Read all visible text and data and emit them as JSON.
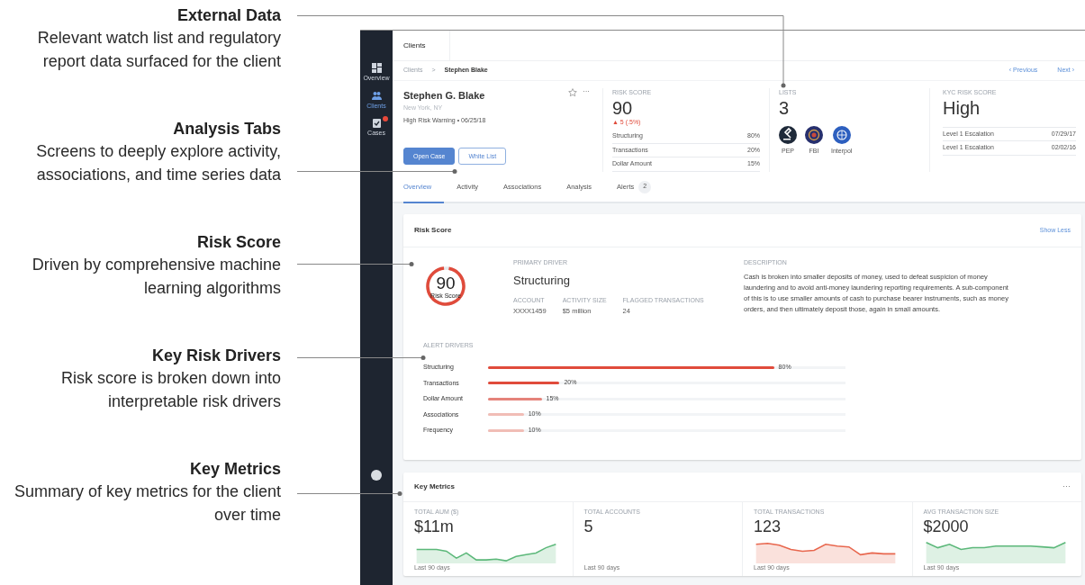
{
  "annotations": [
    {
      "title": "External Data",
      "description": "Relevant watch list and regulatory report data surfaced for the client"
    },
    {
      "title": "Analysis Tabs",
      "description": "Screens to deeply explore activity, associations, and time series data"
    },
    {
      "title": "Risk Score",
      "description": "Driven by comprehensive machine learning algorithms"
    },
    {
      "title": "Key Risk Drivers",
      "description": "Risk score is broken down into interpretable risk drivers"
    },
    {
      "title": "Key Metrics",
      "description": "Summary of key metrics for the client over time"
    }
  ],
  "sidebar": {
    "items": [
      {
        "label": "Overview",
        "kind": "grid",
        "selected": false,
        "badge": false
      },
      {
        "label": "Clients",
        "kind": "people",
        "selected": true,
        "badge": false
      },
      {
        "label": "Cases",
        "kind": "clipboard",
        "selected": false,
        "badge": true
      }
    ]
  },
  "top_tab": "Clients",
  "breadcrumb": {
    "items": [
      "Clients",
      "Stephen Blake"
    ],
    "separator": ">"
  },
  "pager": {
    "previous": "‹ Previous",
    "next": "Next ›"
  },
  "client": {
    "name": "Stephen G. Blake",
    "location": "New York, NY",
    "warning": "High Risk Warning • 06/25/18",
    "starred": false,
    "menu": "···",
    "buttons": [
      {
        "label": "Open Case",
        "kind": "primary"
      },
      {
        "label": "White List",
        "kind": "outline"
      }
    ]
  },
  "risk_score": {
    "label": "RISK SCORE",
    "value": "90",
    "change": "▲ 5 (.5%)",
    "rows": [
      {
        "label": "Structuring",
        "value": "80%"
      },
      {
        "label": "Transactions",
        "value": "20%"
      },
      {
        "label": "Dollar Amount",
        "value": "15%"
      }
    ]
  },
  "lists": {
    "label": "LISTS",
    "value": "3",
    "items": [
      {
        "label": "PEP",
        "kind": "gavel",
        "color": "#1f2a3a"
      },
      {
        "label": "FBI",
        "kind": "seal",
        "color": "#27306e"
      },
      {
        "label": "Interpol",
        "kind": "globe",
        "color": "#2d5fbf"
      }
    ]
  },
  "kyc": {
    "label": "KYC RISK SCORE",
    "value": "High",
    "rows": [
      {
        "label": "Level 1 Escalation",
        "date": "07/29/17"
      },
      {
        "label": "Level 1 Escalation",
        "date": "02/02/16"
      }
    ]
  },
  "tabs": [
    {
      "label": "Overview",
      "selected": true
    },
    {
      "label": "Activity",
      "selected": false
    },
    {
      "label": "Associations",
      "selected": false
    },
    {
      "label": "Analysis",
      "selected": false
    },
    {
      "label": "Alerts",
      "selected": false,
      "count": "2"
    }
  ],
  "risk_card": {
    "title": "Risk Score",
    "action": "Show Less",
    "gauge": {
      "value": "90",
      "label": "Risk Score",
      "level": 0.95
    },
    "primary_driver": {
      "label": "PRIMARY DRIVER",
      "value": "Structuring"
    },
    "stats": [
      {
        "label": "ACCOUNT",
        "value": "XXXX1459"
      },
      {
        "label": "ACTIVITY SIZE",
        "value": "$5 million"
      },
      {
        "label": "FLAGGED TRANSACTIONS",
        "value": "24"
      }
    ],
    "description": {
      "label": "DESCRIPTION",
      "text": "Cash is broken into smaller deposits of money, used to defeat suspicion of money laundering and to avoid anti-money laundering reporting requirements. A sub-component of this is to use smaller amounts of cash to purchase bearer instruments, such as money orders, and then ultimately deposit those, again in small amounts."
    },
    "alert_drivers_label": "ALERT DRIVERS",
    "drivers": [
      {
        "name": "Structuring",
        "level": 0.8,
        "reading": "80%",
        "color": "#e04b3b"
      },
      {
        "name": "Transactions",
        "level": 0.2,
        "reading": "20%",
        "color": "#e04b3b"
      },
      {
        "name": "Dollar Amount",
        "level": 0.15,
        "reading": "15%",
        "color": "#e5837a"
      },
      {
        "name": "Associations",
        "level": 0.1,
        "reading": "10%",
        "color": "#f1bdb6"
      },
      {
        "name": "Frequency",
        "level": 0.1,
        "reading": "10%",
        "color": "#f1bdb6"
      }
    ]
  },
  "key_metrics": {
    "title": "Key Metrics",
    "menu": "···",
    "metrics": [
      {
        "label": "TOTAL AUM ($)",
        "value": "$11m",
        "caption": "Last 90 days",
        "kind": "sparkline",
        "color": "#5cb87a"
      },
      {
        "label": "TOTAL ACCOUNTS",
        "value": "5",
        "caption": "Last 90 days",
        "kind": "plain"
      },
      {
        "label": "TOTAL TRANSACTIONS",
        "value": "123",
        "caption": "Last 90 days",
        "kind": "sparkline",
        "color": "#e8674e"
      },
      {
        "label": "AVG TRANSACTION SIZE",
        "value": "$2000",
        "caption": "Last 90 days",
        "kind": "sparkline",
        "color": "#5cb87a"
      }
    ]
  }
}
